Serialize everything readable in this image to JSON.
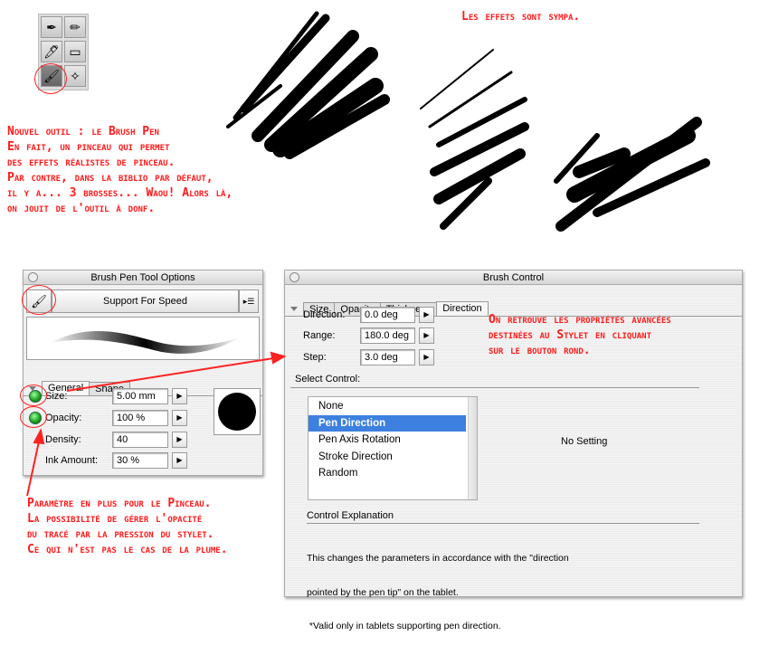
{
  "toolbox": {
    "tools": [
      {
        "icon": "pen-nib-icon",
        "glyph": "✒"
      },
      {
        "icon": "pencil-icon",
        "glyph": "✏"
      },
      {
        "icon": "marker-icon",
        "glyph": "🖊"
      },
      {
        "icon": "eraser-icon",
        "glyph": "▭"
      },
      {
        "icon": "brush-pen-icon",
        "glyph": "🖌"
      },
      {
        "icon": "sparkle-brush-icon",
        "glyph": "✧"
      }
    ],
    "selected": "brush-pen-icon"
  },
  "annotations": {
    "effects": "Les effets sont sympa.",
    "intro": [
      "Nouvel outil : le Brush Pen",
      "En fait, un  pinceau qui permet",
      "des effets réalistes de pinceau.",
      "Par contre, dans la biblio par défaut,",
      "il y a... 3 brosses... Waou! Alors  là,",
      "on jouit de l'outil à donf."
    ],
    "stylet": [
      "On retrouve les propriétés avancées",
      "destinées au Stylet en cliquant",
      "sur le bouton rond."
    ],
    "opacity": [
      "Paramètre en plus pour le Pinceau.",
      "La possibilité de gérer l'opacité",
      "du tracé par la pression du stylet.",
      "Ce qui n'est pas le cas de la plume."
    ]
  },
  "accent_color": "#ff1a1a",
  "tool_options": {
    "title": "Brush Pen Tool Options",
    "preset": "Support For Speed",
    "tabs": [
      "General",
      "Shape"
    ],
    "active_tab": "General",
    "fields": [
      {
        "label": "Size:",
        "value": "5.00 mm",
        "pressure_toggle": true
      },
      {
        "label": "Opacity:",
        "value": "100 %",
        "pressure_toggle": true
      },
      {
        "label": "Density:",
        "value": "40",
        "pressure_toggle": false
      },
      {
        "label": "Ink Amount:",
        "value": "30 %",
        "pressure_toggle": false
      }
    ]
  },
  "brush_control": {
    "title": "Brush Control",
    "tabs": [
      "Size",
      "Opacity",
      "Thickness",
      "Direction"
    ],
    "active_tab": "Direction",
    "fields": [
      {
        "label": "Direction:",
        "value": "0.0 deg"
      },
      {
        "label": "Range:",
        "value": "180.0 deg"
      },
      {
        "label": "Step:",
        "value": "3.0 deg"
      }
    ],
    "select_control_label": "Select Control:",
    "options": [
      "None",
      "Pen Direction",
      "Pen Axis Rotation",
      "Stroke Direction",
      "Random"
    ],
    "selected_option": "Pen Direction",
    "no_setting": "No Setting",
    "explanation_label": "Control Explanation",
    "explanation": [
      "This changes the parameters in accordance with the \"direction",
      "pointed by the pen tip\" on the tablet.",
      " *Valid only in tablets supporting pen direction."
    ]
  }
}
